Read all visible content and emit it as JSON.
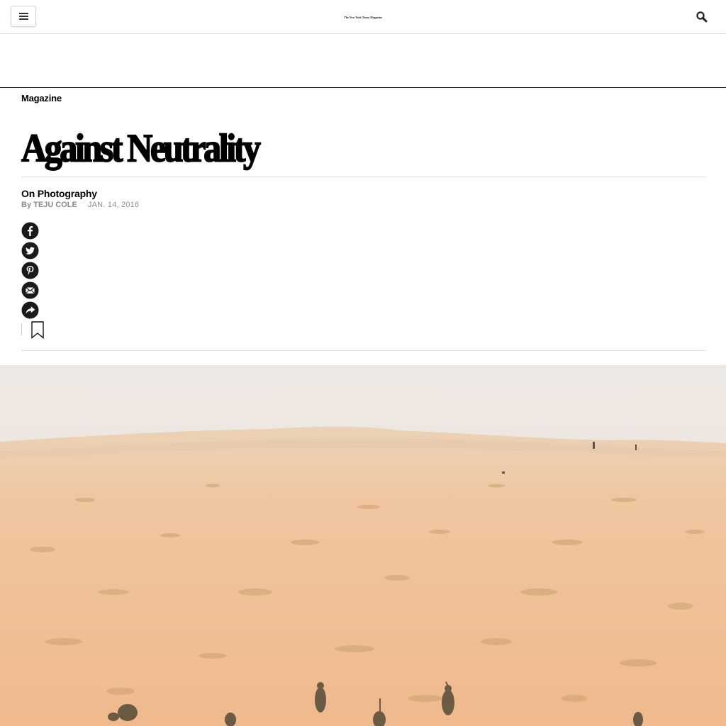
{
  "header": {
    "masthead": "The New York Times Magazine",
    "menu_icon": "hamburger-menu-icon",
    "search_icon": "search-icon"
  },
  "article": {
    "section": "Magazine",
    "headline": "Against Neutrality",
    "column": "On Photography",
    "byline_prefix": "By",
    "author": "TEJU COLE",
    "date": "JAN. 14, 2016"
  },
  "share_tools": [
    {
      "icon": "facebook-icon"
    },
    {
      "icon": "twitter-icon"
    },
    {
      "icon": "pinterest-icon"
    },
    {
      "icon": "email-icon"
    },
    {
      "icon": "share-more-icon"
    }
  ],
  "save_icon": "bookmark-icon",
  "colors": {
    "sky": "#ece6de",
    "sand": "#eeb88e",
    "text_gray": "#999999",
    "rule": "#dcdcdc"
  }
}
